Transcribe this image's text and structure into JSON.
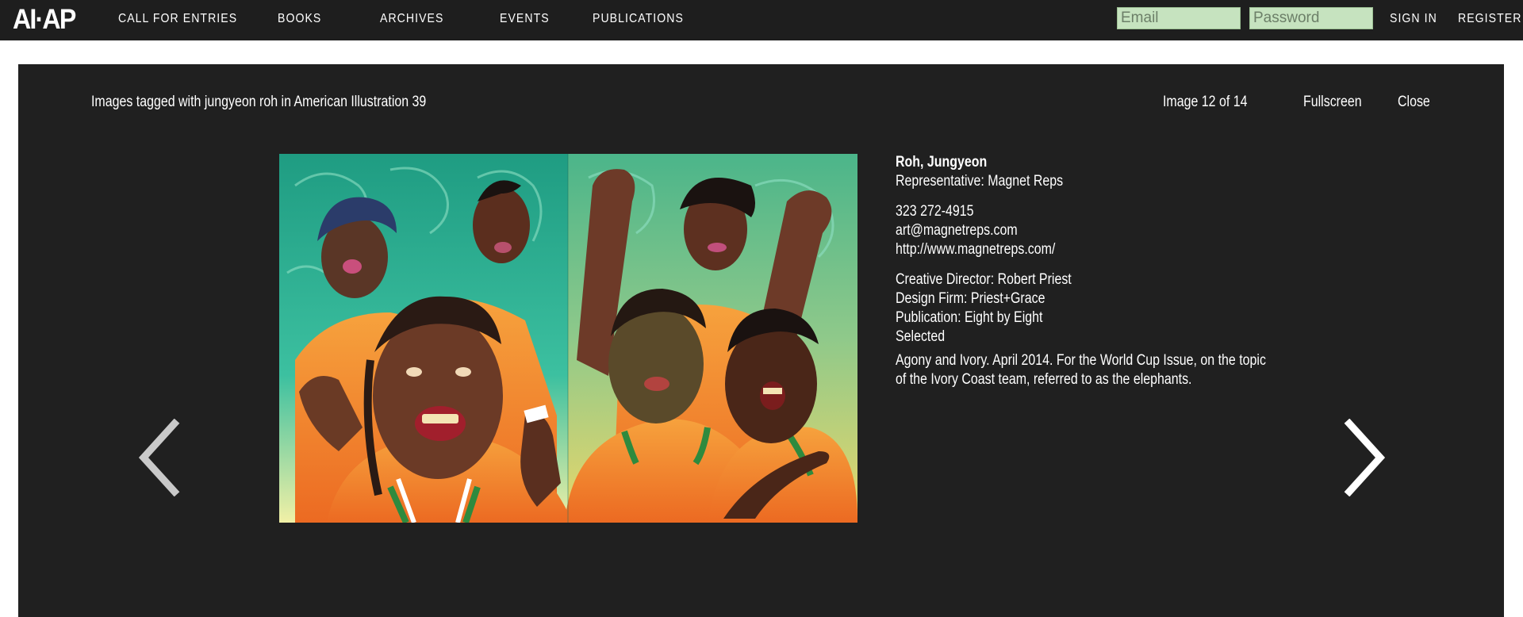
{
  "header": {
    "logo": "AI·AP",
    "nav": [
      {
        "label": "CALL FOR ENTRIES"
      },
      {
        "label": "BOOKS"
      },
      {
        "label": "ARCHIVES"
      },
      {
        "label": "EVENTS"
      },
      {
        "label": "PUBLICATIONS"
      }
    ],
    "email_placeholder": "Email",
    "password_placeholder": "Password",
    "sign_in": "SIGN IN",
    "register": "REGISTER"
  },
  "lightbox": {
    "title": "Images tagged with jungyeon roh in American Illustration 39",
    "counter": "Image 12 of 14",
    "current_image": 12,
    "total_images": 14,
    "fullscreen": "Fullscreen",
    "close": "Close",
    "prev_icon": "chevron-left-icon",
    "next_icon": "chevron-right-icon"
  },
  "info": {
    "artist": "Roh, Jungyeon",
    "representative": "Representative: Magnet Reps",
    "phone": "323 272-4915",
    "email": "art@magnetreps.com",
    "website": "http://www.magnetreps.com/",
    "creative_director": "Creative Director: Robert Priest",
    "design_firm": "Design Firm: Priest+Grace",
    "publication": "Publication: Eight by Eight",
    "status": "Selected",
    "description": "Agony and Ivory. April 2014. For the World Cup Issue, on the topic of the Ivory Coast team, referred to as the elephants."
  },
  "colors": {
    "nav_bg": "#1e1e1e",
    "panel_bg": "#202020",
    "input_bg": "#c6e3bf",
    "jersey_orange": "#f07a2a",
    "background_teal": "#2fae8f"
  }
}
